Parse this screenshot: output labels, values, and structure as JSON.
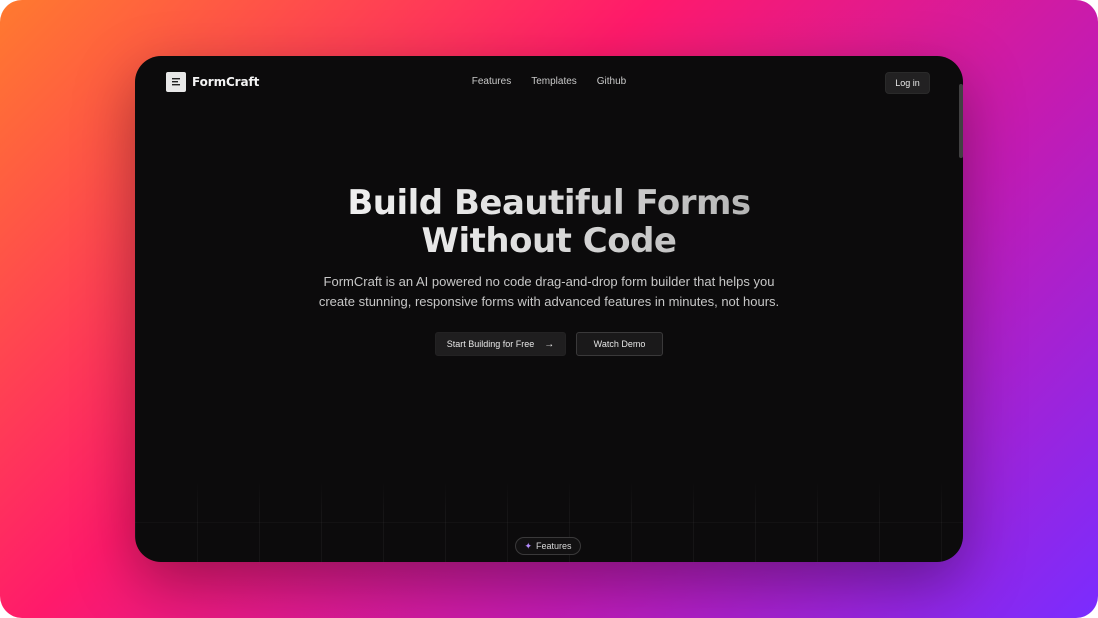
{
  "brand": {
    "name": "FormCraft",
    "logo_icon": "form-logo-icon"
  },
  "nav": {
    "links": [
      "Features",
      "Templates",
      "Github"
    ],
    "login_label": "Log in"
  },
  "hero": {
    "headline_line1": "Build Beautiful Forms",
    "headline_line2": "Without Code",
    "subtitle": "FormCraft is an AI powered no code drag-and-drop form builder that helps you create stunning, responsive forms with advanced features in minutes, not hours.",
    "primary_cta": "Start Building for Free",
    "primary_cta_icon": "arrow-right-icon",
    "secondary_cta": "Watch Demo"
  },
  "features_badge": {
    "label": "Features",
    "icon": "sparkles-icon"
  },
  "colors": {
    "background_gradient": [
      "#ff7a2f",
      "#ff1a6b",
      "#c21bb4",
      "#7a2cff"
    ],
    "window_bg": "#0c0b0c",
    "accent": "#b58cff"
  }
}
